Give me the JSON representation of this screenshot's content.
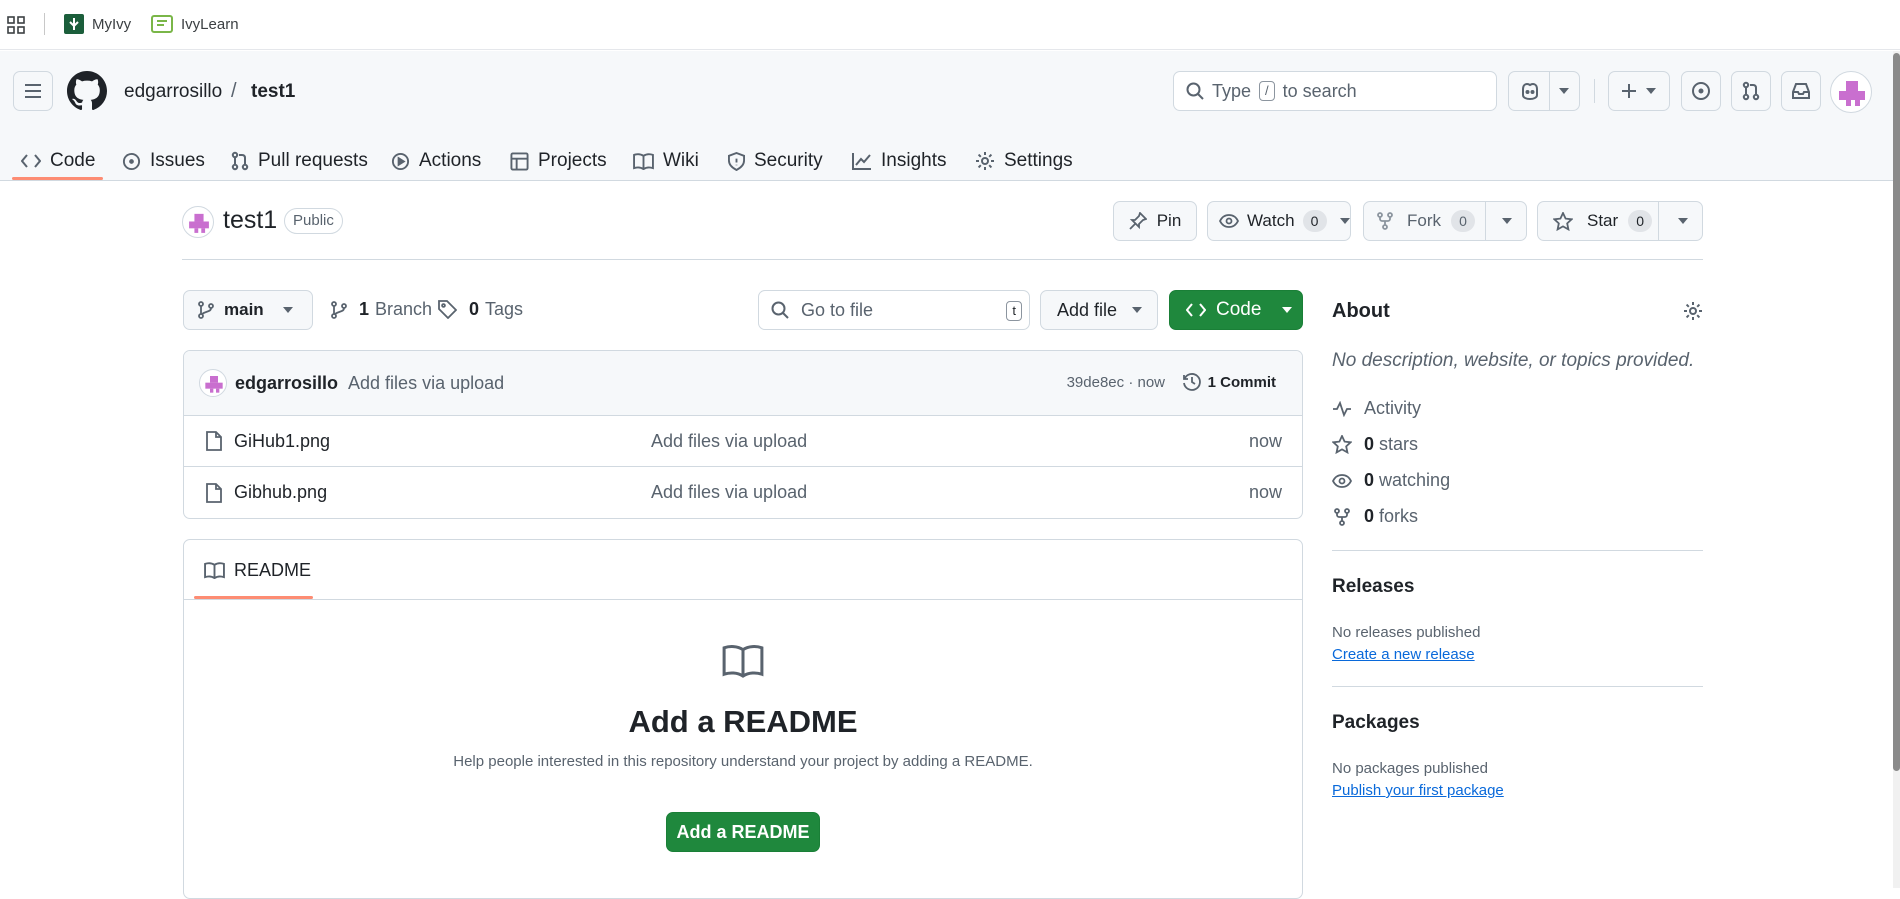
{
  "bookmarks": [
    {
      "label": "MyIvy"
    },
    {
      "label": "IvyLearn"
    }
  ],
  "header": {
    "owner": "edgarrosillo",
    "separator": "/",
    "repo": "test1",
    "search_prefix": "Type",
    "search_key": "/",
    "search_suffix": "to search"
  },
  "tabs": [
    {
      "label": "Code"
    },
    {
      "label": "Issues"
    },
    {
      "label": "Pull requests"
    },
    {
      "label": "Actions"
    },
    {
      "label": "Projects"
    },
    {
      "label": "Wiki"
    },
    {
      "label": "Security"
    },
    {
      "label": "Insights"
    },
    {
      "label": "Settings"
    }
  ],
  "repo": {
    "name": "test1",
    "visibility": "Public",
    "pin_label": "Pin",
    "watch_label": "Watch",
    "watch_count": "0",
    "fork_label": "Fork",
    "fork_count": "0",
    "star_label": "Star",
    "star_count": "0"
  },
  "toolbar": {
    "branch": "main",
    "branch_count": "1",
    "branch_label": "Branch",
    "tag_count": "0",
    "tag_label": "Tags",
    "goto_placeholder": "Go to file",
    "goto_key": "t",
    "add_file_label": "Add file",
    "code_label": "Code"
  },
  "commit": {
    "author": "edgarrosillo",
    "message": "Add files via upload",
    "hash_time": "39de8ec · now",
    "commits_label": "1 Commit"
  },
  "files": [
    {
      "name": "GiHub1.png",
      "message": "Add files via upload",
      "time": "now"
    },
    {
      "name": "Gibhub.png",
      "message": "Add files via upload",
      "time": "now"
    }
  ],
  "readme": {
    "tab_label": "README",
    "title": "Add a README",
    "description": "Help people interested in this repository understand your project by adding a README.",
    "button_label": "Add a README"
  },
  "about": {
    "title": "About",
    "description": "No description, website, or topics provided.",
    "activity_label": "Activity",
    "stars_count": "0",
    "stars_label": "stars",
    "watching_count": "0",
    "watching_label": "watching",
    "forks_count": "0",
    "forks_label": "forks"
  },
  "releases": {
    "title": "Releases",
    "empty": "No releases published",
    "link": "Create a new release"
  },
  "packages": {
    "title": "Packages",
    "empty": "No packages published",
    "link": "Publish your first package"
  },
  "colors": {
    "accent_green": "#1f883d",
    "link_blue": "#0969da",
    "tab_underline": "#fd8c73",
    "avatar_pink": "#c96fcf"
  },
  "icons": [
    "apps-grid-icon",
    "github-logo-icon",
    "copilot-icon",
    "plus-icon",
    "issue-icon",
    "pull-request-icon",
    "inbox-icon",
    "star-icon",
    "eye-icon",
    "fork-icon",
    "gear-icon",
    "book-icon",
    "file-icon",
    "history-icon",
    "search-icon",
    "pin-icon",
    "tag-icon",
    "branch-icon",
    "pulse-icon"
  ]
}
